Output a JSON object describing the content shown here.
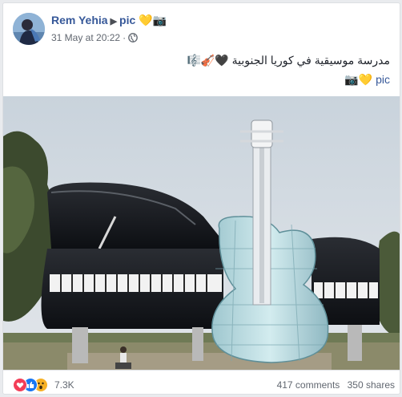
{
  "post": {
    "author": "Rem Yehia",
    "author_suffix": "pic 💛📷",
    "timestamp": "31 May at 20:22",
    "privacy_icon": "globe-icon",
    "caption": "مدرسة موسيقية في كوريا الجنوبية 🖤🎻🎼",
    "hashtag_line": "📷💛 pic"
  },
  "footer": {
    "reactions": [
      "love",
      "like",
      "wow"
    ],
    "reaction_count": "7.3K",
    "comments": "417 comments",
    "shares": "350 shares"
  },
  "colors": {
    "link": "#365899",
    "muted": "#616770",
    "love": "#f33e58",
    "like": "#1877f2",
    "wow": "#f7b125"
  }
}
